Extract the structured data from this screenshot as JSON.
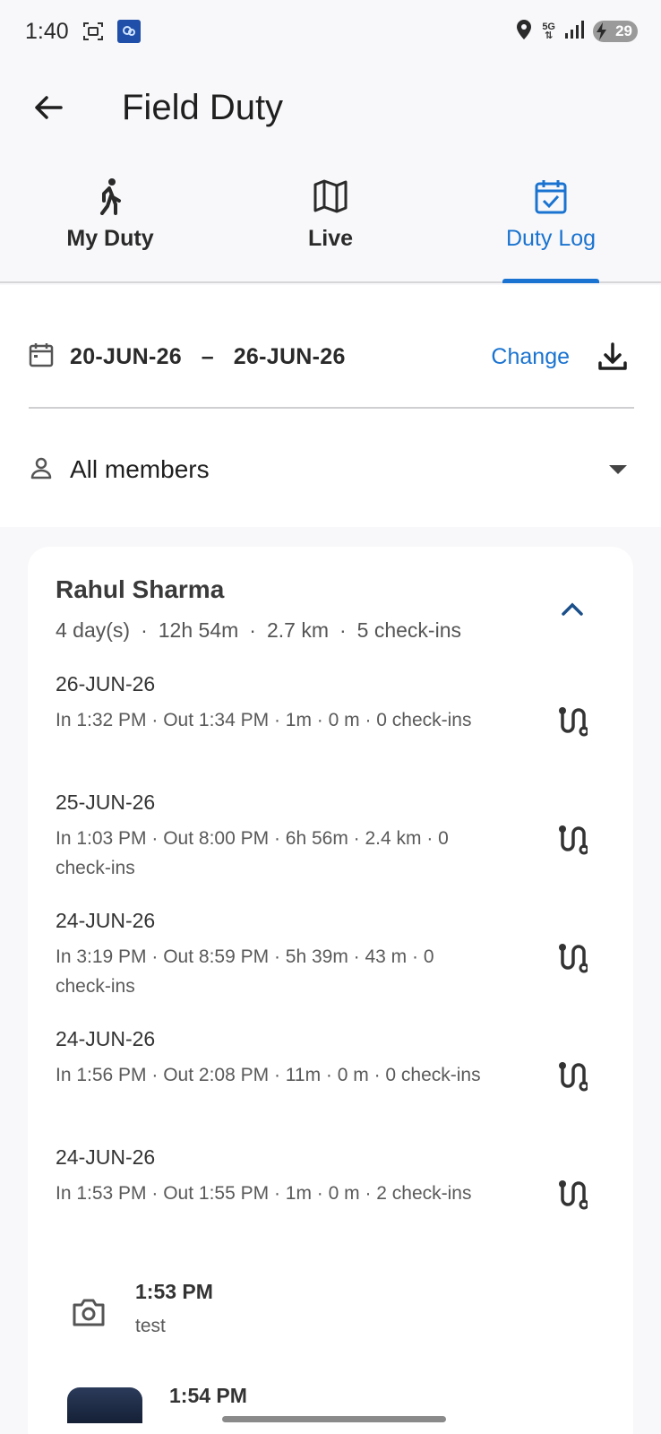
{
  "status_bar": {
    "time": "1:40",
    "battery": "29",
    "network": "5G"
  },
  "app_bar": {
    "title": "Field Duty",
    "back_icon": "arrow-left-icon"
  },
  "tabs": [
    {
      "label": "My Duty",
      "icon": "walking-person-icon",
      "active": false
    },
    {
      "label": "Live",
      "icon": "map-icon",
      "active": false
    },
    {
      "label": "Duty Log",
      "icon": "calendar-check-icon",
      "active": true
    }
  ],
  "filters": {
    "date_start": "20-JUN-26",
    "date_separator": "–",
    "date_end": "26-JUN-26",
    "change_label": "Change",
    "member_label": "All members"
  },
  "card": {
    "name": "Rahul Sharma",
    "summary": {
      "days": "4 day(s)",
      "duration": "12h 54m",
      "distance": "2.7 km",
      "checkins": "5 check-ins"
    },
    "logs": [
      {
        "date": "26-JUN-26",
        "detail": "In 1:32 PM · Out 1:34 PM · 1m · 0 m · 0 check-ins"
      },
      {
        "date": "25-JUN-26",
        "detail": "In 1:03 PM · Out 8:00 PM · 6h 56m · 2.4 km · 0 check-ins"
      },
      {
        "date": "24-JUN-26",
        "detail": "In 3:19 PM · Out 8:59 PM · 5h 39m · 43 m · 0 check-ins"
      },
      {
        "date": "24-JUN-26",
        "detail": "In 1:56 PM · Out 2:08 PM · 11m · 0 m · 0 check-ins"
      },
      {
        "date": "24-JUN-26",
        "detail": "In 1:53 PM · Out 1:55 PM · 1m · 0 m · 2 check-ins"
      }
    ],
    "checkins": [
      {
        "time": "1:53 PM",
        "note": "test",
        "icon": "camera-icon"
      },
      {
        "time": "1:54 PM",
        "note": "",
        "icon": "photo-thumbnail"
      }
    ]
  },
  "colors": {
    "accent": "#1a73d0",
    "background": "#f8f8fa",
    "card": "#ffffff"
  }
}
